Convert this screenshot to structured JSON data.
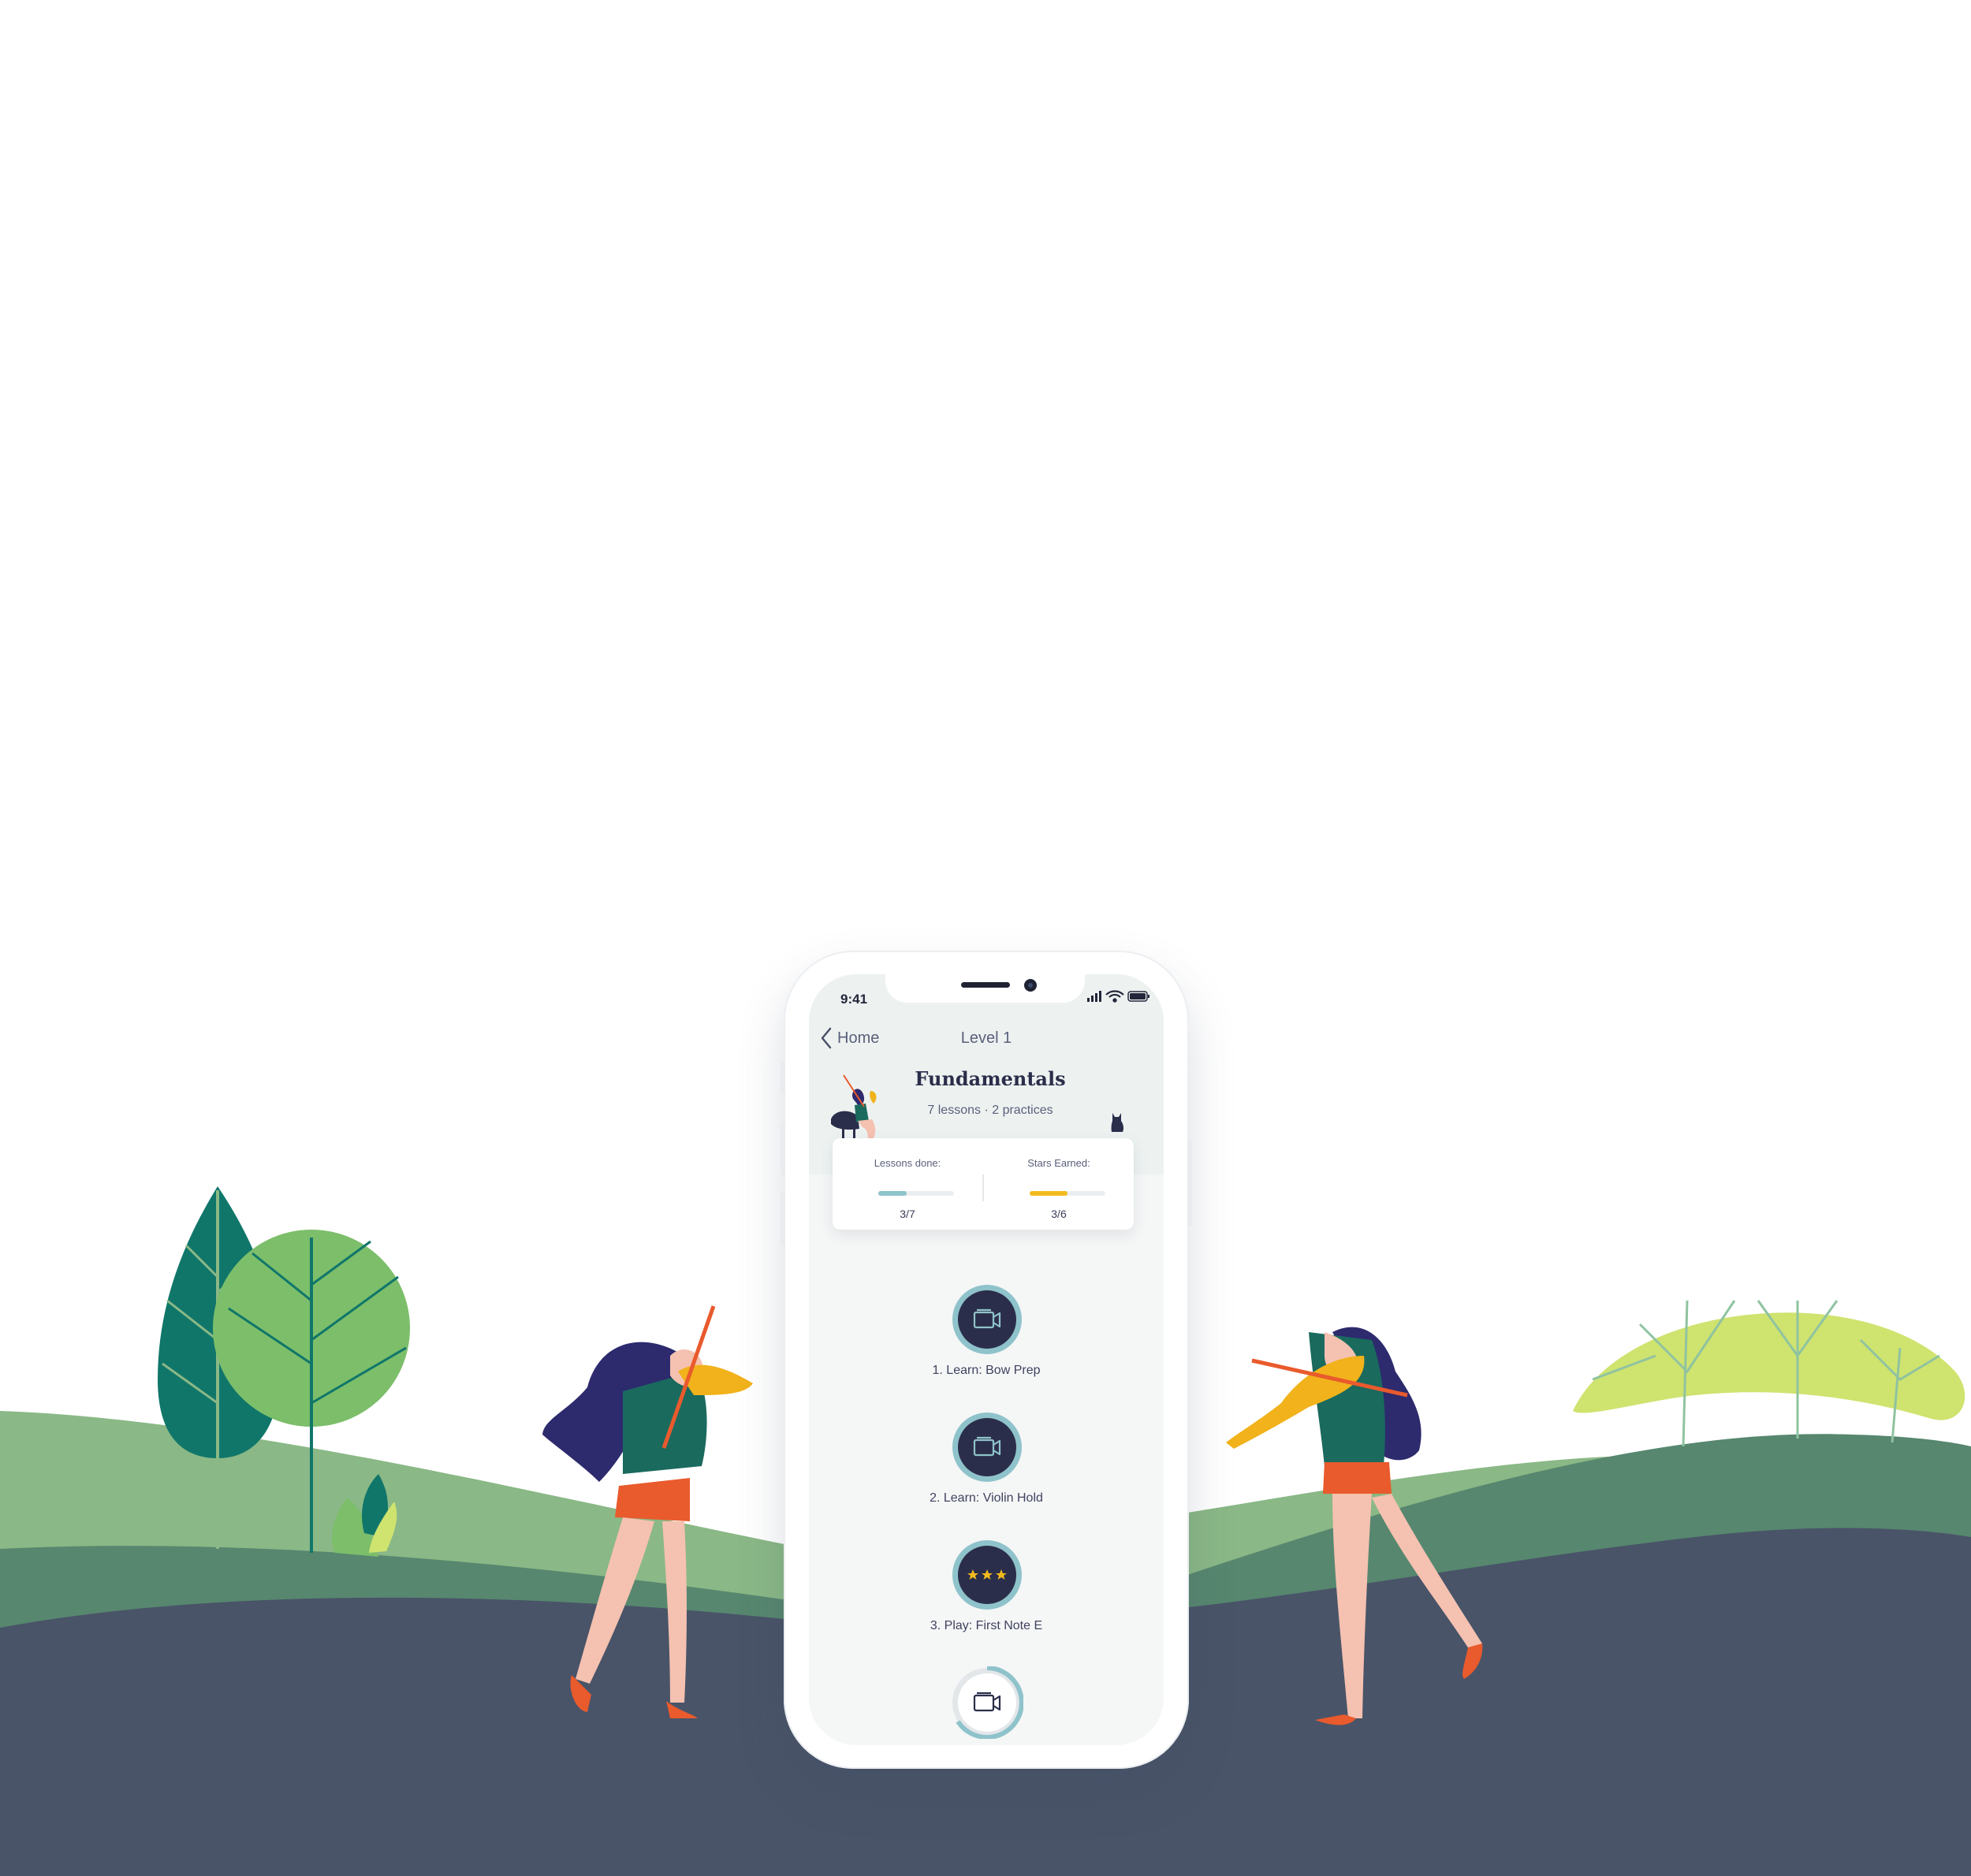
{
  "colors": {
    "ground_dark": "#495468",
    "hill_mid": "#57876f",
    "hill_light": "#8ab886",
    "tree_dark": "#10766a",
    "tree_green": "#7cbe6a",
    "tree_lime": "#cfe36f",
    "accent_teal": "#8fc3cb",
    "accent_yellow": "#f2bb1c",
    "navy": "#2b2e4a"
  },
  "status_bar": {
    "time": "9:41",
    "icons": [
      "signal-icon",
      "wifi-icon",
      "battery-icon"
    ]
  },
  "nav": {
    "back_icon": "chevron-left-icon",
    "back_label": "Home",
    "title": "Level 1"
  },
  "course": {
    "title": "Fundamentals",
    "subtitle": "7 lessons · 2 practices"
  },
  "stats": [
    {
      "label": "Lessons done:",
      "value": "3/7",
      "progress": 0.37,
      "color": "#8fc3cb"
    },
    {
      "label": "Stars Earned:",
      "value": "3/6",
      "progress": 0.5,
      "color": "#f2bb1c"
    }
  ],
  "lessons": [
    {
      "label": "1. Learn: Bow Prep",
      "icon": "video-camera-icon",
      "state": "completed"
    },
    {
      "label": "2. Learn: Violin Hold",
      "icon": "video-camera-icon",
      "state": "completed"
    },
    {
      "label": "3. Play: First Note E",
      "icon": "stars-icon",
      "stars": 3,
      "state": "completed"
    },
    {
      "label": "",
      "icon": "video-camera-icon",
      "state": "current"
    }
  ]
}
